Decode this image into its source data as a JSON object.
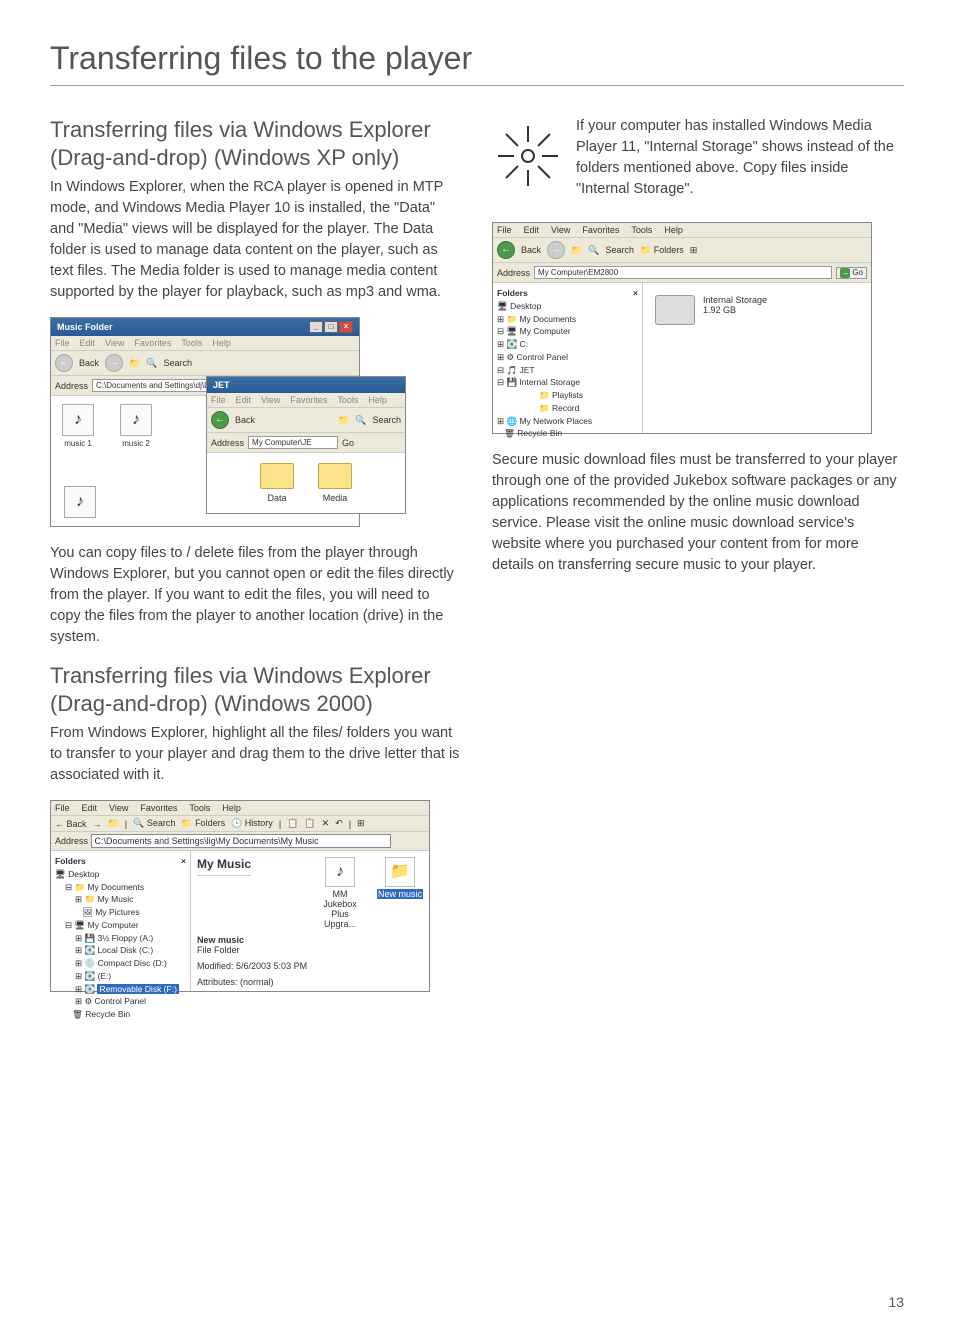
{
  "page": {
    "title": "Transferring files to the player",
    "number": "13"
  },
  "left": {
    "heading1": "Transferring files via Windows Explorer (Drag-and-drop) (Windows XP only)",
    "para1": "In Windows Explorer, when the RCA player is opened in MTP mode, and Windows Media Player 10 is installed, the \"Data\" and \"Media\" views will be displayed for the player. The Data folder is used to manage data content on the player, such as text files. The Media folder is used to manage media content supported by the player for playback, such as mp3 and wma.",
    "para2": "You can copy files to / delete files from the player through Windows Explorer, but you cannot open or edit the files directly from the player. If you want to edit the files, you will need to copy the files from the player to another location (drive) in the system.",
    "heading2": "Transferring files via Windows Explorer (Drag-and-drop) (Windows 2000)",
    "para3": "From Windows Explorer, highlight all the files/ folders you want to transfer to your player and drag them to the drive letter that is associated with it."
  },
  "right": {
    "tip": "If your computer has installed Windows Media Player 11, \"Internal Storage\" shows instead of the folders mentioned above. Copy files inside \"Internal Storage\".",
    "para1": "Secure music download files must be transferred to your player through one of the provided Jukebox software packages or any applications recommended by the online music download service.  Please visit the online music download service's website where you purchased your content from for more details on transferring secure music to your player."
  },
  "ss1": {
    "title": "Music Folder",
    "menu": [
      "File",
      "Edit",
      "View",
      "Favorites",
      "Tools",
      "Help"
    ],
    "back": "Back",
    "search": "Search",
    "address_label": "Address",
    "address_path": "C:\\Documents and Settings\\dj\\Des",
    "icons": [
      {
        "glyph": "♪",
        "label": "music 1"
      },
      {
        "glyph": "♪",
        "label": "music 2"
      },
      {
        "glyph": "♪",
        "label": ""
      }
    ],
    "inner": {
      "title": "JET",
      "menu": [
        "File",
        "Edit",
        "View",
        "Favorites",
        "Tools",
        "Help"
      ],
      "back": "Back",
      "search": "Search",
      "address_label": "Address",
      "address_text": "My Computer\\JE",
      "go": "Go",
      "folders": [
        {
          "label": "Data"
        },
        {
          "label": "Media"
        }
      ]
    }
  },
  "ss2": {
    "menu": [
      "File",
      "Edit",
      "View",
      "Favorites",
      "Tools",
      "Help"
    ],
    "toolbar": [
      "Back",
      "Search",
      "Folders",
      "History"
    ],
    "address_label": "Address",
    "address_path": "C:\\Documents and Settings\\lig\\My Documents\\My Music",
    "tree_header": "Folders",
    "tree": {
      "desktop": "Desktop",
      "mydocs": "My Documents",
      "mymusic": "My Music",
      "mypics": "My Pictures",
      "mycomp": "My Computer",
      "floppy": "3½ Floppy (A:)",
      "localc": "Local Disk (C:)",
      "cd": "Compact Disc (D:)",
      "e": "(E:)",
      "removable": "Removable Disk (F:)",
      "cpanel": "Control Panel",
      "recycle": "Recycle Bin"
    },
    "main_header": "My Music",
    "files": [
      {
        "glyph": "♪",
        "label": "MM Jukebox Plus Upgra..."
      },
      {
        "glyph": "",
        "label": "New music"
      }
    ],
    "meta": {
      "name": "New music",
      "type": "File Folder",
      "modified": "Modified: 5/6/2003 5:03 PM",
      "attrs": "Attributes: (normal)"
    }
  },
  "ss3": {
    "menu": [
      "File",
      "Edit",
      "View",
      "Favorites",
      "Tools",
      "Help"
    ],
    "back": "Back",
    "search": "Search",
    "folders_btn": "Folders",
    "address_label": "Address",
    "address_path": "My Computer\\EM2800",
    "go": "Go",
    "tree_header": "Folders",
    "tree": {
      "desktop": "Desktop",
      "mydocs": "My Documents",
      "mycomp": "My Computer",
      "c": "C:",
      "cpanel": "Control Panel",
      "jet": "JET",
      "internal": "Internal Storage",
      "playlists": "Playlists",
      "record": "Record",
      "netplaces": "My Network Places",
      "recycle": "Recycle Bin"
    },
    "drive": {
      "name": "Internal Storage",
      "size": "1.92 GB"
    }
  }
}
